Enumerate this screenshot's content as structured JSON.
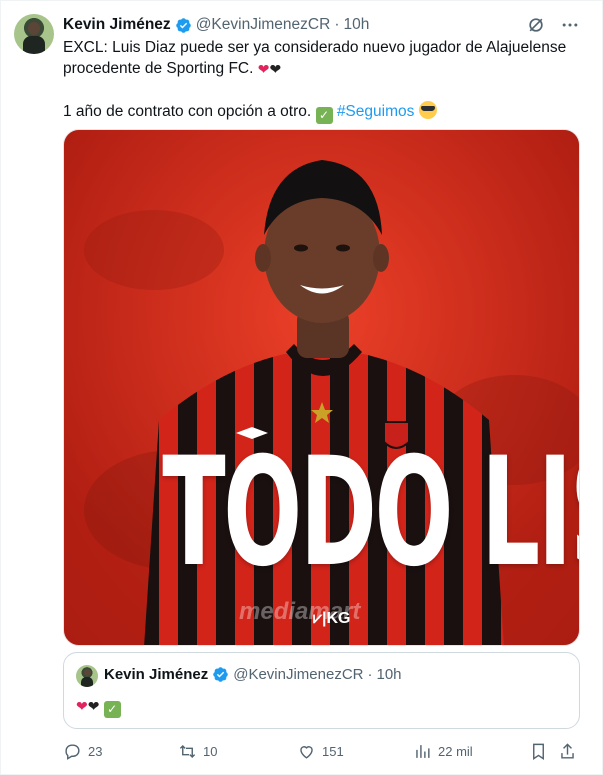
{
  "author": {
    "name": "Kevin Jiménez",
    "handle": "@KevinJimenezCR",
    "separator": "·",
    "time": "10h"
  },
  "tweet": {
    "line1": "EXCL: Luis Diaz puede ser ya considerado nuevo jugador de Alajuelense procedente de Sporting FC.",
    "line2": "1 año de contrato con opción a otro.",
    "hashtag": "#Seguimos"
  },
  "media": {
    "headline": "TODO LISTO",
    "sponsor_text": "mediamart",
    "logo_text": "⩗|KG"
  },
  "quote": {
    "name": "Kevin Jiménez",
    "handle": "@KevinJimenezCR",
    "separator": "·",
    "time": "10h"
  },
  "stats": {
    "replies": "23",
    "retweets": "10",
    "likes": "151",
    "views": "22 mil"
  },
  "icons": [
    "verified-badge-icon",
    "grok-icon",
    "more-icon",
    "reply-icon",
    "retweet-icon",
    "like-icon",
    "views-icon",
    "bookmark-icon",
    "share-icon"
  ],
  "colors": {
    "accent": "#1d9bf0",
    "text": "#0f1419",
    "muted": "#536471",
    "media_red": "#d82a1a",
    "verified": "#1d9bf0"
  }
}
